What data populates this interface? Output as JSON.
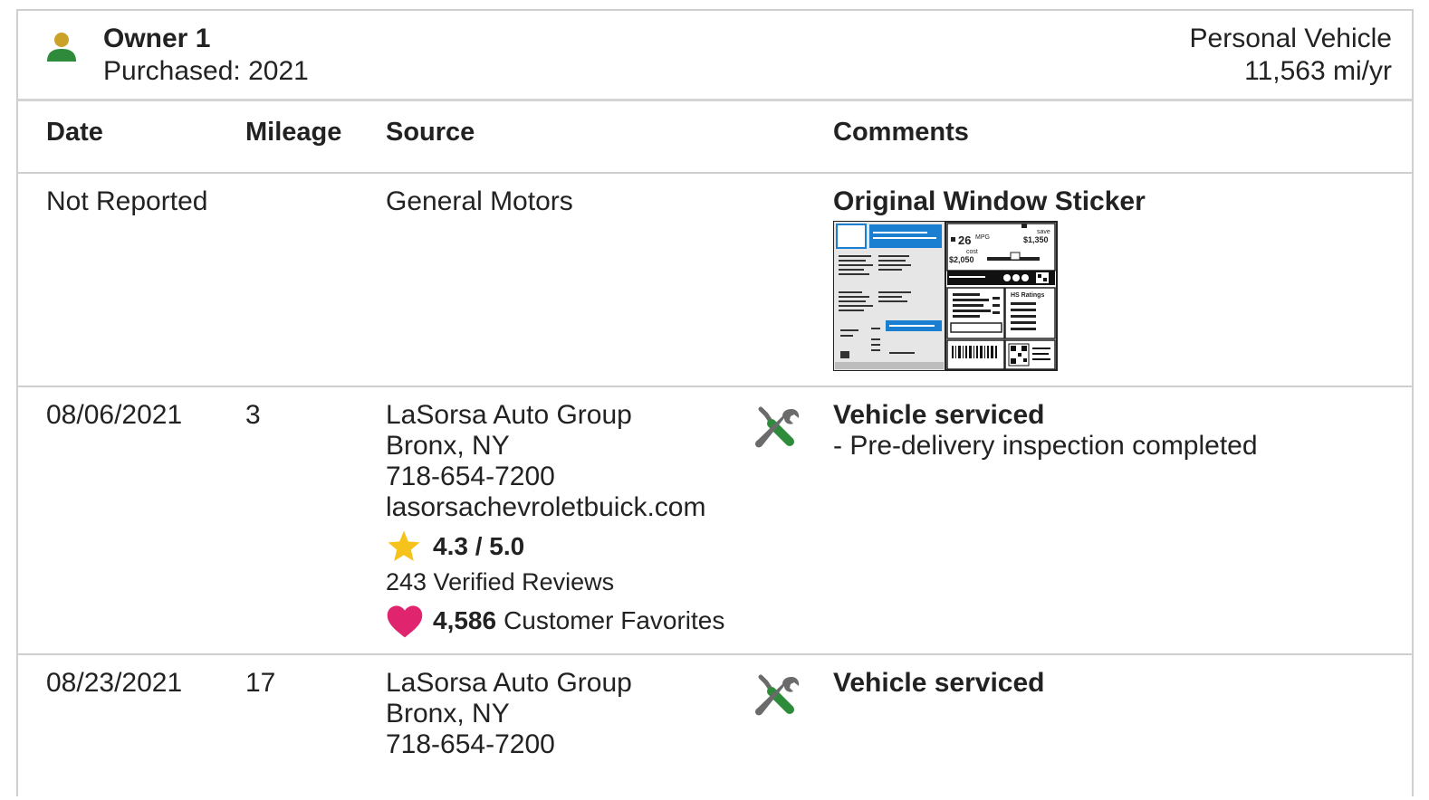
{
  "owner": {
    "name": "Owner 1",
    "purchased": "Purchased: 2021",
    "vehicle_type": "Personal Vehicle",
    "usage": "11,563 mi/yr"
  },
  "columns": [
    "Date",
    "Mileage",
    "Source",
    "Comments"
  ],
  "rows": [
    {
      "date": "Not Reported",
      "mileage": "",
      "source": {
        "name": "General Motors"
      },
      "comment_title": "Original Window Sticker",
      "sticker": {
        "mpg": "26",
        "mpg_unit": "MPG",
        "save_label": "save",
        "save": "$1,350",
        "cost_label": "cost",
        "cost": "$2,050",
        "ratings_label": "HS Ratings"
      }
    },
    {
      "date": "08/06/2021",
      "mileage": "3",
      "source": {
        "name": "LaSorsa Auto Group",
        "location": "Bronx, NY",
        "phone": "718-654-7200",
        "website": "lasorsachevroletbuick.com",
        "rating": "4.3 / 5.0",
        "reviews": "243 Verified Reviews",
        "favorites_count": "4,586",
        "favorites_label": "Customer Favorites"
      },
      "comment_title": "Vehicle serviced",
      "comment_detail": "- Pre-delivery inspection completed"
    },
    {
      "date": "08/23/2021",
      "mileage": "17",
      "source": {
        "name": "LaSorsa Auto Group",
        "location": "Bronx, NY",
        "phone": "718-654-7200"
      },
      "comment_title": "Vehicle serviced"
    }
  ],
  "icons": {
    "owner": "person-icon",
    "service": "wrench-screwdriver-icon",
    "rating": "star-icon",
    "favorites": "heart-icon"
  },
  "colors": {
    "person_head": "#c9a227",
    "person_body": "#2e8b3a",
    "tool_green": "#2e8b3a",
    "tool_gray": "#6b6b6b",
    "star": "#f6c21c",
    "heart": "#e0246d",
    "sticker_blue": "#1a7fd1"
  }
}
